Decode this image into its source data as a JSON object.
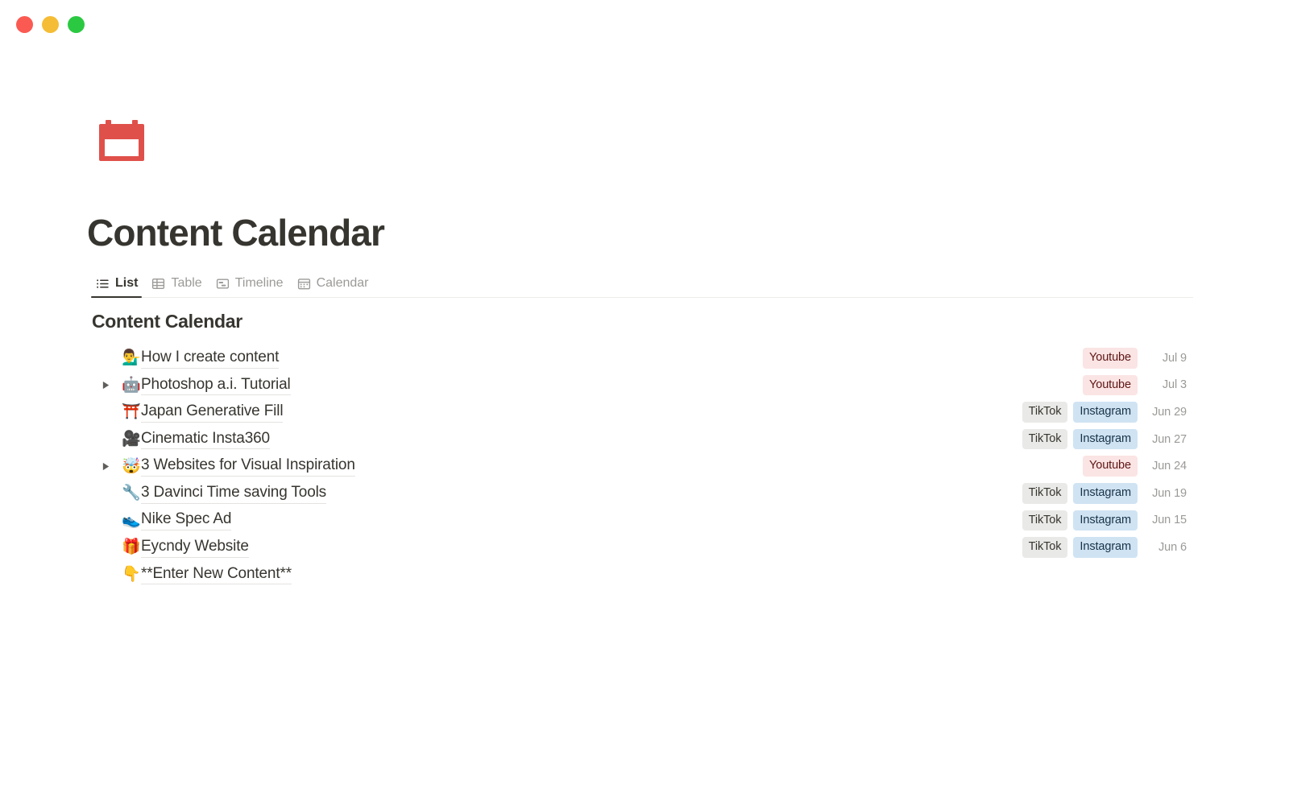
{
  "window": {
    "traffic_lights": [
      {
        "name": "close",
        "color": "#fb5a52"
      },
      {
        "name": "minimize",
        "color": "#f5bd36"
      },
      {
        "name": "zoom",
        "color": "#2bc942"
      }
    ]
  },
  "page": {
    "icon": "calendar-icon",
    "icon_color": "#e0504a",
    "title": "Content Calendar"
  },
  "view_tabs": [
    {
      "label": "List",
      "icon": "list-icon",
      "active": true
    },
    {
      "label": "Table",
      "icon": "table-icon",
      "active": false
    },
    {
      "label": "Timeline",
      "icon": "timeline-icon",
      "active": false
    },
    {
      "label": "Calendar",
      "icon": "calendar-view-icon",
      "active": false
    }
  ],
  "section": {
    "title": "Content Calendar"
  },
  "colors": {
    "accent_red": "#e0504a",
    "tag_youtube_bg": "#fbe4e4",
    "tag_youtube_text": "#5d1715",
    "tag_tiktok_bg": "#e9e9e7",
    "tag_tiktok_text": "#37352f",
    "tag_instagram_bg": "#cfe3f3",
    "tag_instagram_text": "#183347",
    "text_primary": "#37352f",
    "text_muted": "#9b9a97"
  },
  "list": {
    "rows": [
      {
        "emoji": "💁‍♂️",
        "emoji_name": "person-tipping-hand-emoji",
        "title": "How I create content",
        "has_toggle": false,
        "tags": [
          {
            "label": "Youtube",
            "type": "youtube"
          }
        ],
        "date": "Jul 9"
      },
      {
        "emoji": "🤖",
        "emoji_name": "robot-emoji",
        "title": "Photoshop a.i. Tutorial",
        "has_toggle": true,
        "tags": [
          {
            "label": "Youtube",
            "type": "youtube"
          }
        ],
        "date": "Jul 3"
      },
      {
        "emoji": "⛩️",
        "emoji_name": "torii-gate-emoji",
        "title": "Japan Generative Fill",
        "has_toggle": false,
        "tags": [
          {
            "label": "TikTok",
            "type": "tiktok"
          },
          {
            "label": "Instagram",
            "type": "instagram"
          }
        ],
        "date": "Jun 29"
      },
      {
        "emoji": "🎥",
        "emoji_name": "movie-camera-emoji",
        "title": "Cinematic Insta360",
        "has_toggle": false,
        "tags": [
          {
            "label": "TikTok",
            "type": "tiktok"
          },
          {
            "label": "Instagram",
            "type": "instagram"
          }
        ],
        "date": "Jun 27"
      },
      {
        "emoji": "🤯",
        "emoji_name": "exploding-head-emoji",
        "title": "3 Websites for Visual Inspiration",
        "has_toggle": true,
        "tags": [
          {
            "label": "Youtube",
            "type": "youtube"
          }
        ],
        "date": "Jun 24"
      },
      {
        "emoji": "🔧",
        "emoji_name": "wrench-emoji",
        "title": "3 Davinci Time saving Tools",
        "has_toggle": false,
        "tags": [
          {
            "label": "TikTok",
            "type": "tiktok"
          },
          {
            "label": "Instagram",
            "type": "instagram"
          }
        ],
        "date": "Jun 19"
      },
      {
        "emoji": "👟",
        "emoji_name": "running-shoe-emoji",
        "title": "Nike Spec Ad",
        "has_toggle": false,
        "tags": [
          {
            "label": "TikTok",
            "type": "tiktok"
          },
          {
            "label": "Instagram",
            "type": "instagram"
          }
        ],
        "date": "Jun 15"
      },
      {
        "emoji": "🎁",
        "emoji_name": "gift-emoji",
        "title": "Eycndy Website",
        "has_toggle": false,
        "tags": [
          {
            "label": "TikTok",
            "type": "tiktok"
          },
          {
            "label": "Instagram",
            "type": "instagram"
          }
        ],
        "date": "Jun 6"
      },
      {
        "emoji": "👇",
        "emoji_name": "backhand-index-pointing-down-emoji",
        "title": "**Enter New Content**",
        "has_toggle": false,
        "tags": [],
        "date": ""
      }
    ]
  }
}
